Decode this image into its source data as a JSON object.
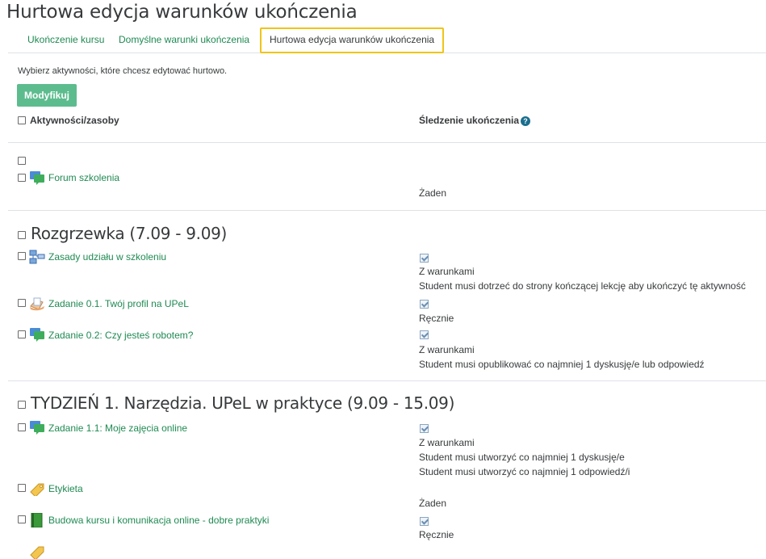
{
  "page": {
    "title": "Hurtowa edycja warunków ukończenia"
  },
  "tabs": [
    {
      "label": "Ukończenie kursu"
    },
    {
      "label": "Domyślne warunki ukończenia"
    },
    {
      "label": "Hurtowa edycja warunków ukończenia",
      "active": true
    }
  ],
  "instructions": "Wybierz aktywności, które chcesz edytować hurtowo.",
  "modify_button": "Modyfikuj",
  "table_header": {
    "activities": "Aktywności/zasoby",
    "tracking": "Śledzenie ukończenia",
    "help_icon": "?"
  },
  "sections": [
    {
      "title": "",
      "activities": [
        {
          "name": "Forum szkolenia",
          "icon": "forum-icon",
          "completion": "Żaden",
          "checked": false
        }
      ]
    },
    {
      "title": "Rozgrzewka (7.09 - 9.09)",
      "activities": [
        {
          "name": "Zasady udziału w szkoleniu",
          "icon": "lesson-icon",
          "completion": "Z warunkami",
          "checked": true,
          "conditions": [
            "Student musi dotrzeć do strony kończącej lekcję aby ukończyć tę aktywność"
          ]
        },
        {
          "name": "Zadanie 0.1. Twój profil na UPeL",
          "icon": "assignment-icon",
          "completion": "Ręcznie",
          "checked": true
        },
        {
          "name": "Zadanie 0.2: Czy jesteś robotem?",
          "icon": "forum-icon",
          "completion": "Z warunkami",
          "checked": true,
          "conditions": [
            "Student musi opublikować co najmniej 1 dyskusję/e lub odpowiedź"
          ]
        }
      ]
    },
    {
      "title": "TYDZIEŃ 1. Narzędzia. UPeL w praktyce (9.09 - 15.09)",
      "activities": [
        {
          "name": "Zadanie 1.1: Moje zajęcia online",
          "icon": "forum-icon",
          "completion": "Z warunkami",
          "checked": true,
          "conditions": [
            "Student musi utworzyć co najmniej 1 dyskusję/e",
            "Student musi utworzyć co najmniej 1 odpowiedź/i"
          ]
        },
        {
          "name": "Etykieta",
          "icon": "label-icon",
          "completion": "Żaden",
          "checked": false
        },
        {
          "name": "Budowa kursu i komunikacja online - dobre praktyki",
          "icon": "book-icon",
          "completion": "Ręcznie",
          "checked": true
        }
      ]
    }
  ]
}
